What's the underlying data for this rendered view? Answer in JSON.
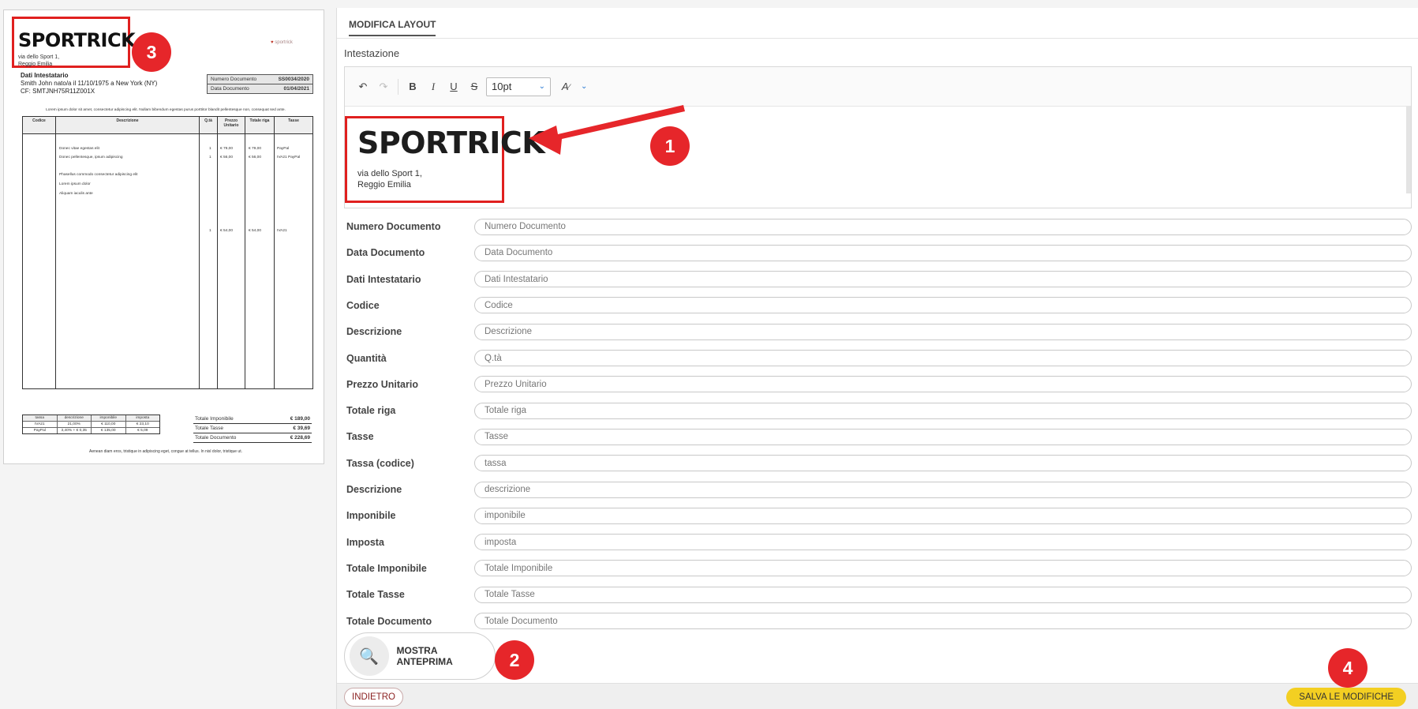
{
  "preview": {
    "logo": "SPORTRICK",
    "addr1": "via dello Sport 1,",
    "addr2": "Reggio Emilia",
    "brand": "sportrick",
    "intest_title": "Dati Intestatario",
    "intest_line1": "Smith John nato/a il 11/10/1975 a New York (NY)",
    "intest_line2": "CF: SMTJNH75R11Z001X",
    "doc_num_label": "Numero Documento",
    "doc_num_value": "SS0034/2020",
    "doc_date_label": "Data Documento",
    "doc_date_value": "01/04/2021",
    "lorem": "Lorem ipsum dolor sit amet, consectetur adipiscing elit. Nullam bibendum egestas purus porttitor blandit pellentesque non, consequat sed ante.",
    "headers": [
      "Codice",
      "Descrizione",
      "Q.tà",
      "Prezzo Unitario",
      "Totale riga",
      "Tasse"
    ],
    "rows": [
      {
        "desc": "Donec vitae egestas elit",
        "qty": "1",
        "price": "€ 79,00",
        "total": "€ 79,00",
        "tax": "PayPal"
      },
      {
        "desc": "Donec pellentesque, ipsum adipiscing",
        "qty": "1",
        "price": "€ 56,00",
        "total": "€ 56,00",
        "tax": "IVA21 PayPal"
      },
      {
        "desc": "Phasellus commodo consectetur adipiscing elit",
        "qty": "",
        "price": "",
        "total": "",
        "tax": ""
      },
      {
        "desc": "Lorem ipsum dolor",
        "qty": "",
        "price": "",
        "total": "",
        "tax": ""
      },
      {
        "desc": "Aliquam iaculis ante",
        "qty": "",
        "price": "",
        "total": "",
        "tax": ""
      },
      {
        "desc": "",
        "qty": "1",
        "price": "€ 54,00",
        "total": "€ 54,00",
        "tax": "IVA21"
      }
    ],
    "tax_headers": [
      "tassa",
      "descrizione",
      "imponibile",
      "imposta"
    ],
    "tax_rows": [
      [
        "IVA21",
        "21,00%",
        "€ 110,00",
        "€ 23,10"
      ],
      [
        "PayPal",
        "3,40% + € 0,35",
        "€ 135,00",
        "€ 5,09"
      ]
    ],
    "totals": [
      {
        "label": "Totale Imponibile",
        "value": "€ 189,00"
      },
      {
        "label": "Totale Tasse",
        "value": "€ 39,69"
      },
      {
        "label": "Totale Documento",
        "value": "€ 228,69"
      }
    ],
    "footer": "Aenean diam eros, tristique in adipiscing eget, congue at tellus. In nisl dolor, tristique ut."
  },
  "editor": {
    "tab": "MODIFICA LAYOUT",
    "section": "Intestazione",
    "font_size": "10pt",
    "logo": "SPORTRICK",
    "addr1": "via dello Sport 1,",
    "addr2": "Reggio Emilia",
    "fields": [
      {
        "label": "Numero Documento",
        "placeholder": "Numero Documento"
      },
      {
        "label": "Data Documento",
        "placeholder": "Data Documento"
      },
      {
        "label": "Dati Intestatario",
        "placeholder": "Dati Intestatario"
      },
      {
        "label": "Codice",
        "placeholder": "Codice"
      },
      {
        "label": "Descrizione",
        "placeholder": "Descrizione"
      },
      {
        "label": "Quantità",
        "placeholder": "Q.tà"
      },
      {
        "label": "Prezzo Unitario",
        "placeholder": "Prezzo Unitario"
      },
      {
        "label": "Totale riga",
        "placeholder": "Totale riga"
      },
      {
        "label": "Tasse",
        "placeholder": "Tasse"
      },
      {
        "label": "Tassa (codice)",
        "placeholder": "tassa"
      },
      {
        "label": "Descrizione",
        "placeholder": "descrizione"
      },
      {
        "label": "Imponibile",
        "placeholder": "imponibile"
      },
      {
        "label": "Imposta",
        "placeholder": "imposta"
      },
      {
        "label": "Totale Imponibile",
        "placeholder": "Totale Imponibile"
      },
      {
        "label": "Totale Tasse",
        "placeholder": "Totale Tasse"
      },
      {
        "label": "Totale Documento",
        "placeholder": "Totale Documento"
      }
    ],
    "preview_button": "MOSTRA ANTEPRIMA",
    "back_button": "INDIETRO",
    "save_button": "SALVA LE MODIFICHE"
  },
  "annotations": [
    "1",
    "2",
    "3",
    "4"
  ],
  "colors": {
    "annotation": "#e6262a",
    "save": "#f3cf22",
    "back_text": "#8a1f1f"
  }
}
